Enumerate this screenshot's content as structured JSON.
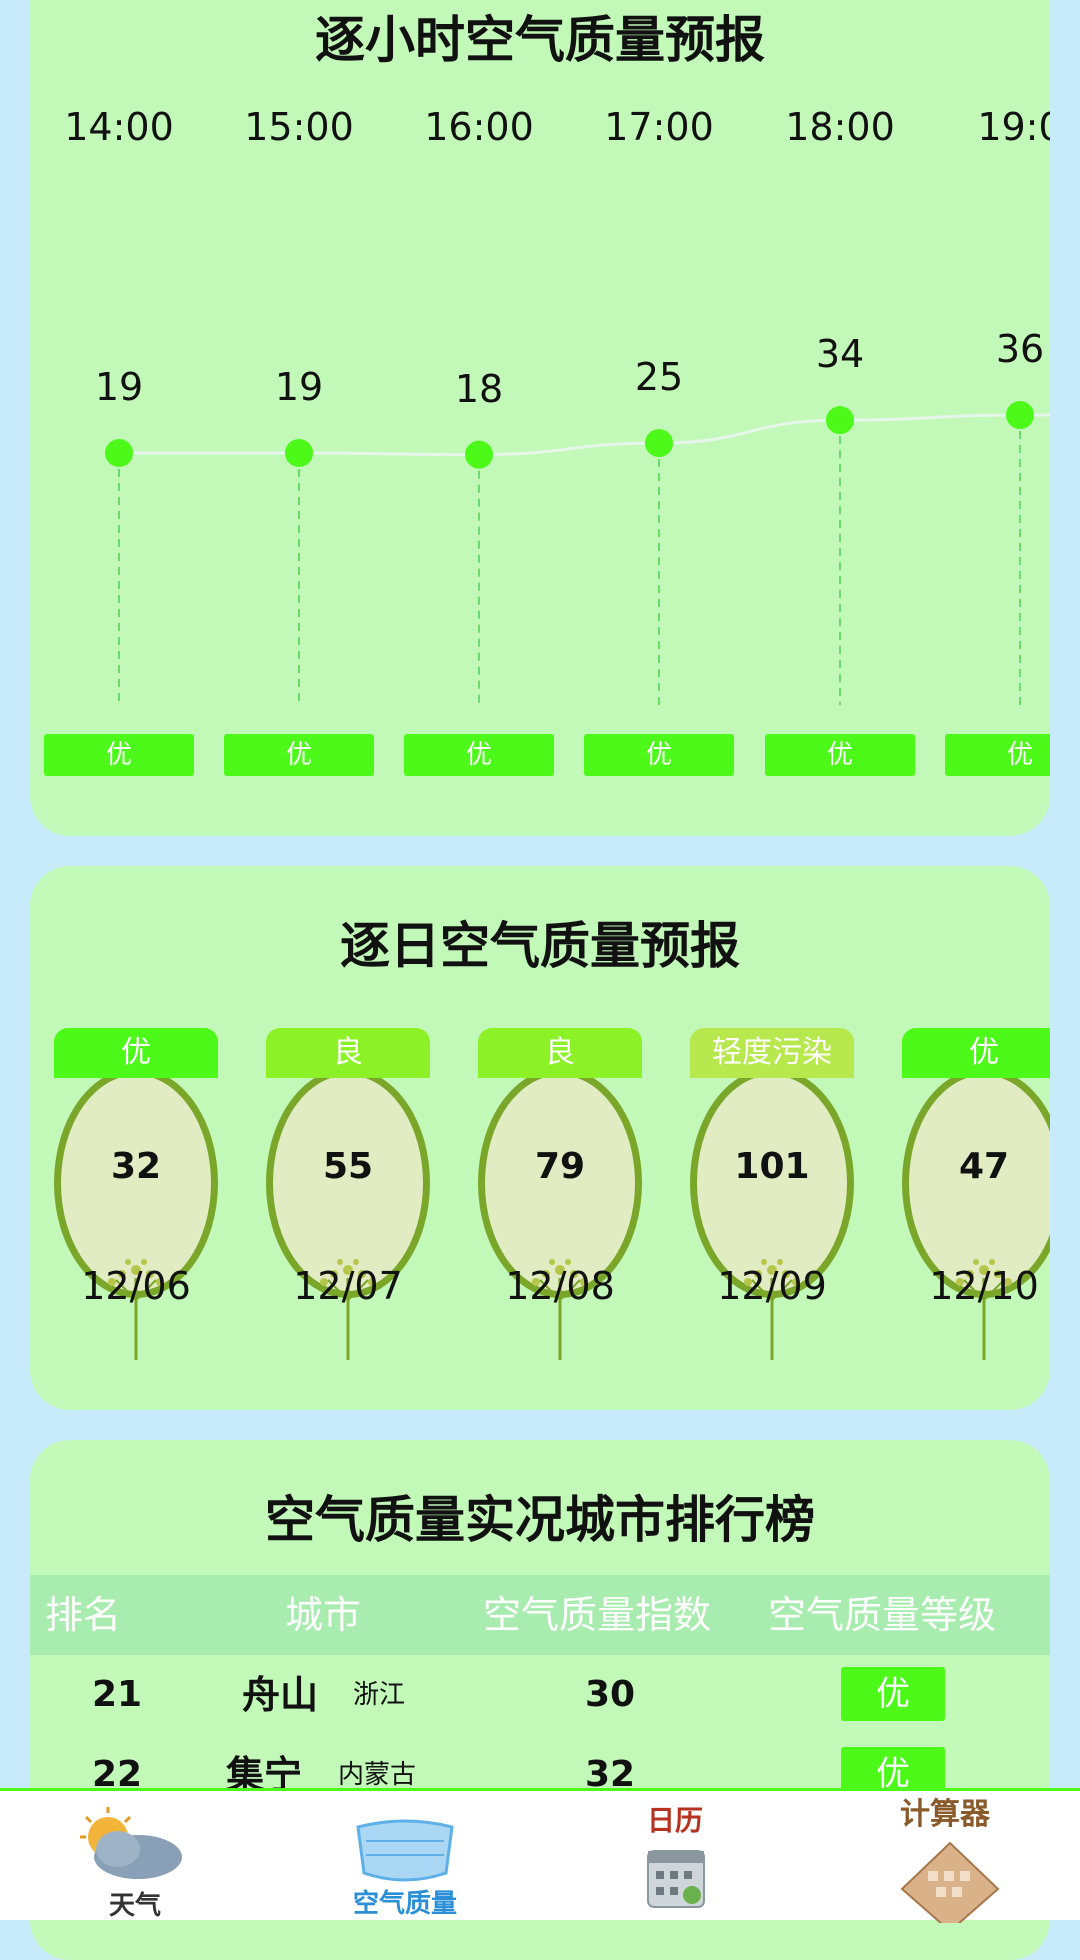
{
  "hourly": {
    "title": "逐小时空气质量预报",
    "items": [
      {
        "time": "14:00",
        "aqi": "19",
        "level": "优"
      },
      {
        "time": "15:00",
        "aqi": "19",
        "level": "优"
      },
      {
        "time": "16:00",
        "aqi": "18",
        "level": "优"
      },
      {
        "time": "17:00",
        "aqi": "25",
        "level": "优"
      },
      {
        "time": "18:00",
        "aqi": "34",
        "level": "优"
      },
      {
        "time": "19:0",
        "aqi": "36",
        "level": "优"
      }
    ]
  },
  "daily": {
    "title": "逐日空气质量预报",
    "items": [
      {
        "level": "优",
        "aqi": "32",
        "date": "12/06",
        "color": "#4cf919"
      },
      {
        "level": "良",
        "aqi": "55",
        "date": "12/07",
        "color": "#8cf227"
      },
      {
        "level": "良",
        "aqi": "79",
        "date": "12/08",
        "color": "#8cf227"
      },
      {
        "level": "轻度污染",
        "aqi": "101",
        "date": "12/09",
        "color": "#b7e84d"
      },
      {
        "level": "优",
        "aqi": "47",
        "date": "12/10",
        "color": "#4cf919"
      }
    ]
  },
  "ranking": {
    "title": "空气质量实况城市排行榜",
    "headers": [
      "排名",
      "城市",
      "空气质量指数",
      "空气质量等级"
    ],
    "rows": [
      {
        "rank": "21",
        "city": "舟山",
        "province": "浙江",
        "aqi": "30",
        "level": "优"
      },
      {
        "rank": "22",
        "city": "集宁",
        "province": "内蒙古",
        "aqi": "32",
        "level": "优"
      }
    ]
  },
  "nav": {
    "items": [
      {
        "label": "天气",
        "icon": "weather-icon"
      },
      {
        "label": "空气质量",
        "icon": "mask-icon"
      },
      {
        "label": "日历",
        "icon": "calendar-icon"
      },
      {
        "label": "计算器",
        "icon": "calculator-icon"
      }
    ]
  },
  "colors": {
    "accent": "#4cf919",
    "card": "#c2f8b8",
    "background": "#c7ebfb"
  }
}
